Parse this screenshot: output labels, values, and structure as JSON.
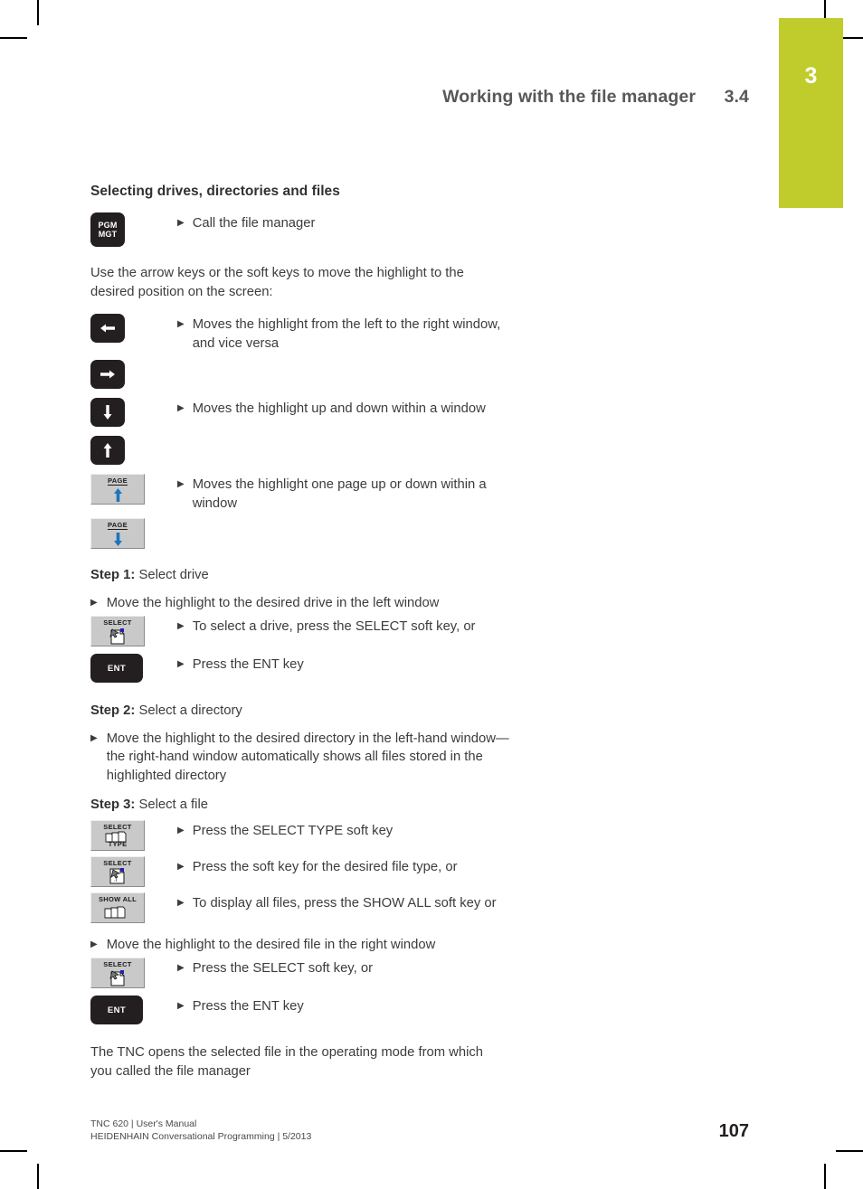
{
  "chapter": {
    "number": "3"
  },
  "header": {
    "title": "Working with the file manager",
    "section": "3.4"
  },
  "content": {
    "section_title": "Selecting drives, directories and files",
    "intro_paragraph": "Use the arrow keys or the soft keys to move the highlight to the desired position on the screen:",
    "call_file_manager": "Call the file manager",
    "arrow_left_right_desc": "Moves the highlight from the left to the right window, and vice versa",
    "arrow_up_down_desc": "Moves the highlight up and down within a window",
    "page_keys_desc": "Moves the highlight one page up or down within a window",
    "step1_label": "Step 1:",
    "step1_title": "Select drive",
    "step1_bullet": "Move the highlight to the desired drive in the left window",
    "step1_select": "To select a drive, press the SELECT soft key, or",
    "step1_ent": "Press the ENT key",
    "step2_label": "Step 2:",
    "step2_title": "Select a directory",
    "step2_bullet": "Move the highlight to the desired directory in the left-hand window—the right-hand window automatically shows all files stored in the highlighted directory",
    "step3_label": "Step 3:",
    "step3_title": "Select a file",
    "step3_select_type": "Press the SELECT TYPE soft key",
    "step3_file_type": "Press the soft key for the desired file type, or",
    "step3_show_all": "To display all files, press the SHOW ALL soft key or",
    "step3_bullet": "Move the highlight to the desired file in the right window",
    "step3_select": "Press the SELECT soft key, or",
    "step3_ent": "Press the ENT key",
    "closing_paragraph": "The TNC opens the selected file in the operating mode from which you called the file manager"
  },
  "keys": {
    "pgm_mgt_line1": "PGM",
    "pgm_mgt_line2": "MGT",
    "ent": "ENT",
    "page_label": "PAGE",
    "select_label": "SELECT",
    "type_label": "TYPE",
    "show_all_label": "SHOW ALL"
  },
  "icons": {
    "bullet": "▶",
    "arrow_left": "arrow-left-icon",
    "arrow_right": "arrow-right-icon",
    "arrow_down": "arrow-down-icon",
    "arrow_up": "arrow-up-icon",
    "page_up": "page-up-icon",
    "page_down": "page-down-icon"
  },
  "footer": {
    "line1": "TNC 620 | User's Manual",
    "line2": "HEIDENHAIN Conversational Programming | 5/2013",
    "page_number": "107"
  },
  "colors": {
    "chapter_tab": "#bfcc2b",
    "key_black": "#231f20",
    "softkey_gray": "#c9c9c9",
    "blue_arrow": "#1b75bb",
    "text": "#3c3c3b"
  }
}
